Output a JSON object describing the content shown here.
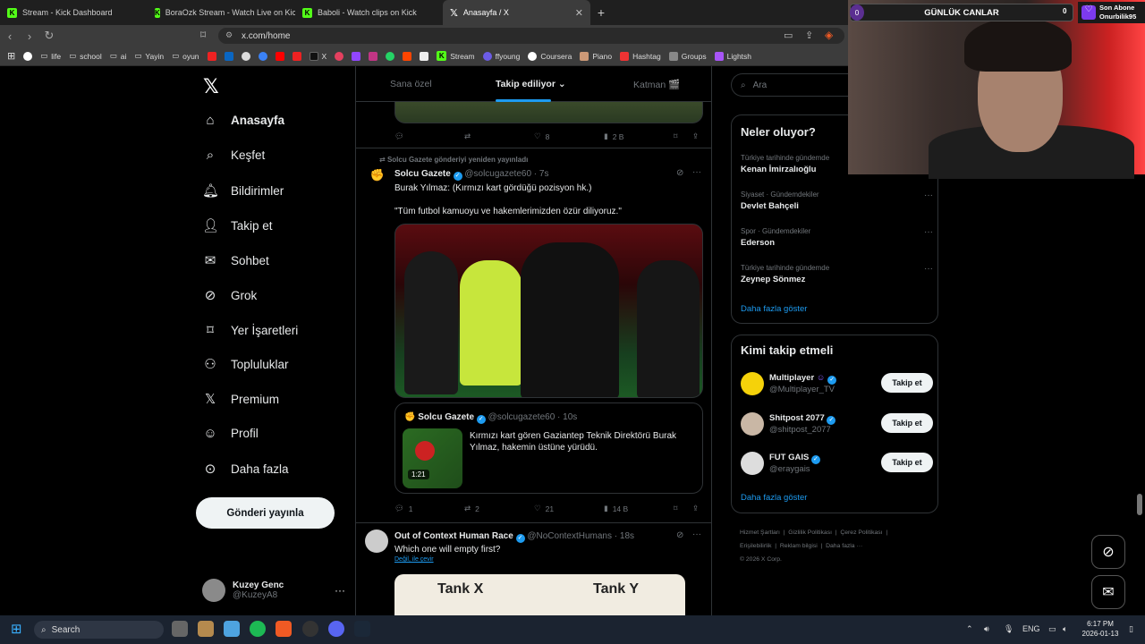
{
  "browser": {
    "tabs": [
      {
        "title": "Stream - Kick Dashboard",
        "icon": "kick-icon"
      },
      {
        "title": "BoraOzk Stream - Watch Live on Kick",
        "icon": "kick-icon"
      },
      {
        "title": "Baboli - Watch clips on Kick",
        "icon": "kick-icon"
      },
      {
        "title": "Anasayfa / X",
        "icon": "x-icon",
        "active": true
      }
    ],
    "url": "x.com/home",
    "bookmarks": [
      "life",
      "school",
      "ai",
      "Yayin",
      "oyun",
      "X",
      "Stream",
      "ffyoung",
      "Coursera",
      "Piano",
      "Hashtag",
      "Groups",
      "Lightsh"
    ]
  },
  "nav": {
    "items": [
      {
        "label": "Anasayfa",
        "icon": "home-icon",
        "glyph": "⌂"
      },
      {
        "label": "Keşfet",
        "icon": "search-icon",
        "glyph": "⌕"
      },
      {
        "label": "Bildirimler",
        "icon": "bell-icon",
        "glyph": "🔔︎"
      },
      {
        "label": "Takip et",
        "icon": "follow-icon",
        "glyph": "👤︎"
      },
      {
        "label": "Sohbet",
        "icon": "mail-icon",
        "glyph": "✉"
      },
      {
        "label": "Grok",
        "icon": "grok-icon",
        "glyph": "⊘"
      },
      {
        "label": "Yer İşaretleri",
        "icon": "bookmark-icon",
        "glyph": "⌑"
      },
      {
        "label": "Topluluklar",
        "icon": "communities-icon",
        "glyph": "⚇"
      },
      {
        "label": "Premium",
        "icon": "x-icon",
        "glyph": "𝕏"
      },
      {
        "label": "Profil",
        "icon": "profile-icon",
        "glyph": "☺"
      },
      {
        "label": "Daha fazla",
        "icon": "more-circle-icon",
        "glyph": "⊙"
      }
    ],
    "post_button": "Gönderi yayınla",
    "account": {
      "name": "Kuzey Genc",
      "handle": "@KuzeyA8"
    }
  },
  "timeline": {
    "tabs": [
      "Sana özel",
      "Takip ediliyor",
      "Katman 🎬"
    ],
    "top_actions": {
      "likes": "8",
      "views": "2 B"
    },
    "post1": {
      "repost_note": "Solcu Gazete gönderiyi yeniden yayınladı",
      "author": "Solcu Gazete",
      "handle": "@solcugazete60",
      "time": "7s",
      "text1": "Burak Yılmaz: (Kırmızı kart gördüğü pozisyon hk.)",
      "text2": "\"Tüm futbol kamuoyu ve hakemlerimizden özür diliyoruz.\"",
      "quote": {
        "author": "Solcu Gazete",
        "handle": "@solcugazete60",
        "time": "10s",
        "text": "Kırmızı kart gören Gaziantep Teknik Direktörü Burak Yılmaz, hakemin üstüne yürüdü.",
        "duration": "1:21"
      },
      "replies": "1",
      "reposts": "2",
      "likes": "21",
      "views": "14 B"
    },
    "post2": {
      "author": "Out of Context Human Race",
      "handle": "@NoContextHumans",
      "time": "18s",
      "text": "Which one will empty first?",
      "translate": "Değil, ile çevir",
      "image_labels": [
        "Tank X",
        "Tank Y"
      ]
    }
  },
  "right": {
    "search_placeholder": "Ara",
    "trends_title": "Neler oluyor?",
    "trends": [
      {
        "context": "Türkiye tarihinde gündemde",
        "name": "Kenan İmirzalıoğlu"
      },
      {
        "context": "Siyaset · Gündemdekiler",
        "name": "Devlet Bahçeli"
      },
      {
        "context": "Spor · Gündemdekiler",
        "name": "Ederson"
      },
      {
        "context": "Türkiye tarihinde gündemde",
        "name": "Zeynep Sönmez"
      }
    ],
    "show_more": "Daha fazla göster",
    "who_title": "Kimi takip etmeli",
    "who": [
      {
        "name": "Multiplayer",
        "handle": "@Multiplayer_TV",
        "button": "Takip et",
        "color": "#f5d20a"
      },
      {
        "name": "Shitpost 2077",
        "handle": "@shitpost_2077",
        "button": "Takip et",
        "color": "#c9b7a5"
      },
      {
        "name": "FUT GAIS",
        "handle": "@eraygais",
        "button": "Takip et",
        "color": "#dddddd"
      }
    ],
    "footer": [
      "Hizmet Şartları",
      "Gizlilik Politikası",
      "Çerez Politikası",
      "Erişilebilirlik",
      "Reklam bilgisi",
      "Daha fazla ···",
      "© 2026 X Corp."
    ]
  },
  "overlay": {
    "banner": "GÜNLÜK CANLAR",
    "count": "0",
    "count_right": "0",
    "sub_label": "Son Abone",
    "sub_name": "Onurbilik95"
  },
  "taskbar": {
    "search": "Search",
    "lang": "ENG",
    "time": "6:17 PM",
    "date": "2026-01-13"
  }
}
